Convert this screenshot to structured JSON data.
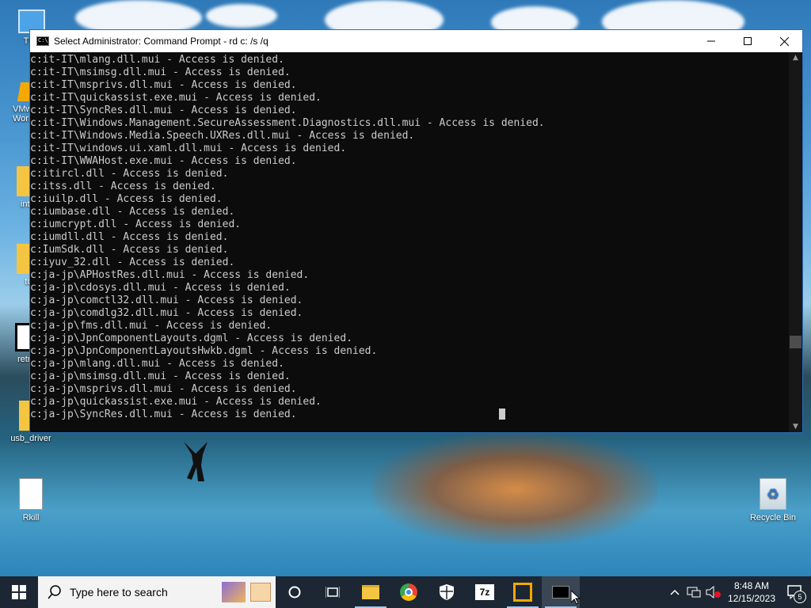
{
  "desktop": {
    "icons": [
      {
        "label": "This"
      },
      {
        "label": "VMware Workstation"
      },
      {
        "label": "intel"
      },
      {
        "label": "to"
      },
      {
        "label": "retroc"
      },
      {
        "label": "usb_driver"
      },
      {
        "label": "Rkill"
      },
      {
        "label": "Recycle Bin"
      }
    ]
  },
  "window": {
    "title": "Select Administrator: Command Prompt - rd  c: /s /q",
    "console_lines": [
      "c:it-IT\\mlang.dll.mui - Access is denied.",
      "c:it-IT\\msimsg.dll.mui - Access is denied.",
      "c:it-IT\\msprivs.dll.mui - Access is denied.",
      "c:it-IT\\quickassist.exe.mui - Access is denied.",
      "c:it-IT\\SyncRes.dll.mui - Access is denied.",
      "c:it-IT\\Windows.Management.SecureAssessment.Diagnostics.dll.mui - Access is denied.",
      "c:it-IT\\Windows.Media.Speech.UXRes.dll.mui - Access is denied.",
      "c:it-IT\\windows.ui.xaml.dll.mui - Access is denied.",
      "c:it-IT\\WWAHost.exe.mui - Access is denied.",
      "c:itircl.dll - Access is denied.",
      "c:itss.dll - Access is denied.",
      "c:iuilp.dll - Access is denied.",
      "c:iumbase.dll - Access is denied.",
      "c:iumcrypt.dll - Access is denied.",
      "c:iumdll.dll - Access is denied.",
      "c:IumSdk.dll - Access is denied.",
      "c:iyuv_32.dll - Access is denied.",
      "c:ja-jp\\APHostRes.dll.mui - Access is denied.",
      "c:ja-jp\\cdosys.dll.mui - Access is denied.",
      "c:ja-jp\\comctl32.dll.mui - Access is denied.",
      "c:ja-jp\\comdlg32.dll.mui - Access is denied.",
      "c:ja-jp\\fms.dll.mui - Access is denied.",
      "c:ja-jp\\JpnComponentLayouts.dgml - Access is denied.",
      "c:ja-jp\\JpnComponentLayoutsHwkb.dgml - Access is denied.",
      "c:ja-jp\\mlang.dll.mui - Access is denied.",
      "c:ja-jp\\msimsg.dll.mui - Access is denied.",
      "c:ja-jp\\msprivs.dll.mui - Access is denied.",
      "c:ja-jp\\quickassist.exe.mui - Access is denied.",
      "c:ja-jp\\SyncRes.dll.mui - Access is denied."
    ]
  },
  "taskbar": {
    "search_placeholder": "Type here to search",
    "time": "8:48 AM",
    "date": "12/15/2023",
    "notification_count": "5"
  },
  "colors": {
    "console_bg": "#0c0c0c",
    "console_text": "#cccccc",
    "taskbar_bg": "#1c2733",
    "window_border": "#2b6cb8"
  }
}
